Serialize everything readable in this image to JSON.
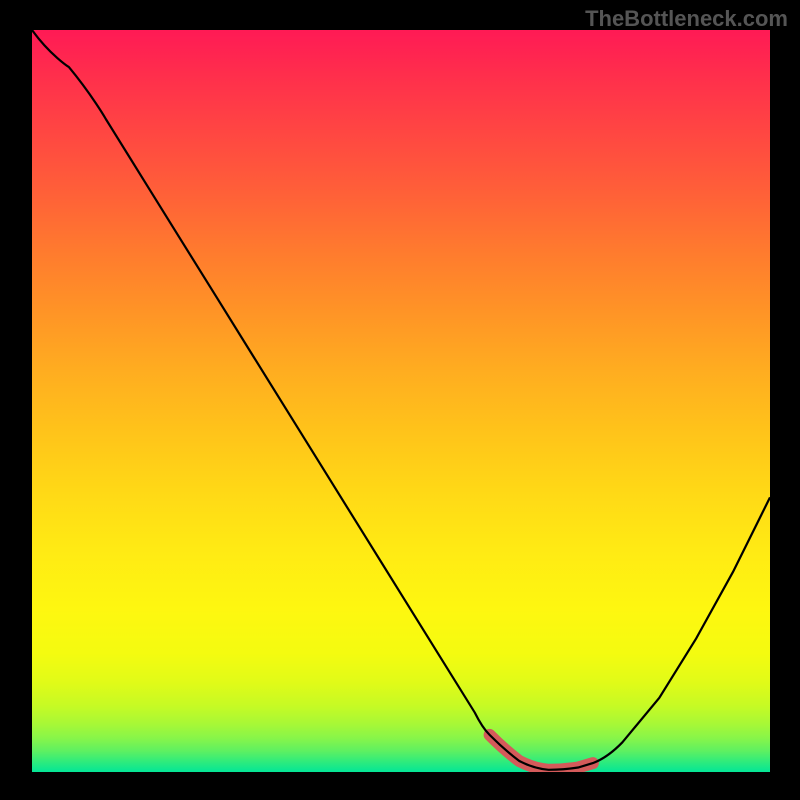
{
  "watermark": "TheBottleneck.com",
  "chart_data": {
    "type": "line",
    "title": "",
    "xlabel": "",
    "ylabel": "",
    "xlim": [
      0,
      100
    ],
    "ylim": [
      0,
      100
    ],
    "series": [
      {
        "name": "bottleneck-curve",
        "x": [
          0,
          5,
          10,
          15,
          20,
          25,
          30,
          35,
          40,
          45,
          50,
          55,
          60,
          62,
          64,
          66,
          68,
          70,
          72,
          74,
          76,
          80,
          85,
          90,
          95,
          100
        ],
        "y": [
          100,
          95,
          88,
          80,
          72,
          64,
          56,
          48,
          40,
          32,
          24,
          16,
          8,
          5,
          3,
          1.5,
          0.7,
          0.3,
          0.3,
          0.6,
          1.2,
          4,
          10,
          18,
          27,
          37
        ]
      },
      {
        "name": "optimal-range",
        "x": [
          62,
          64,
          66,
          68,
          70,
          72,
          74,
          76
        ],
        "y": [
          5,
          3,
          1.5,
          0.7,
          0.3,
          0.3,
          0.6,
          1.2
        ]
      }
    ],
    "background_gradient": {
      "top": "#ff1a55",
      "mid_upper": "#ff9426",
      "mid": "#ffea14",
      "mid_lower": "#a8f836",
      "bottom": "#04e697"
    }
  }
}
